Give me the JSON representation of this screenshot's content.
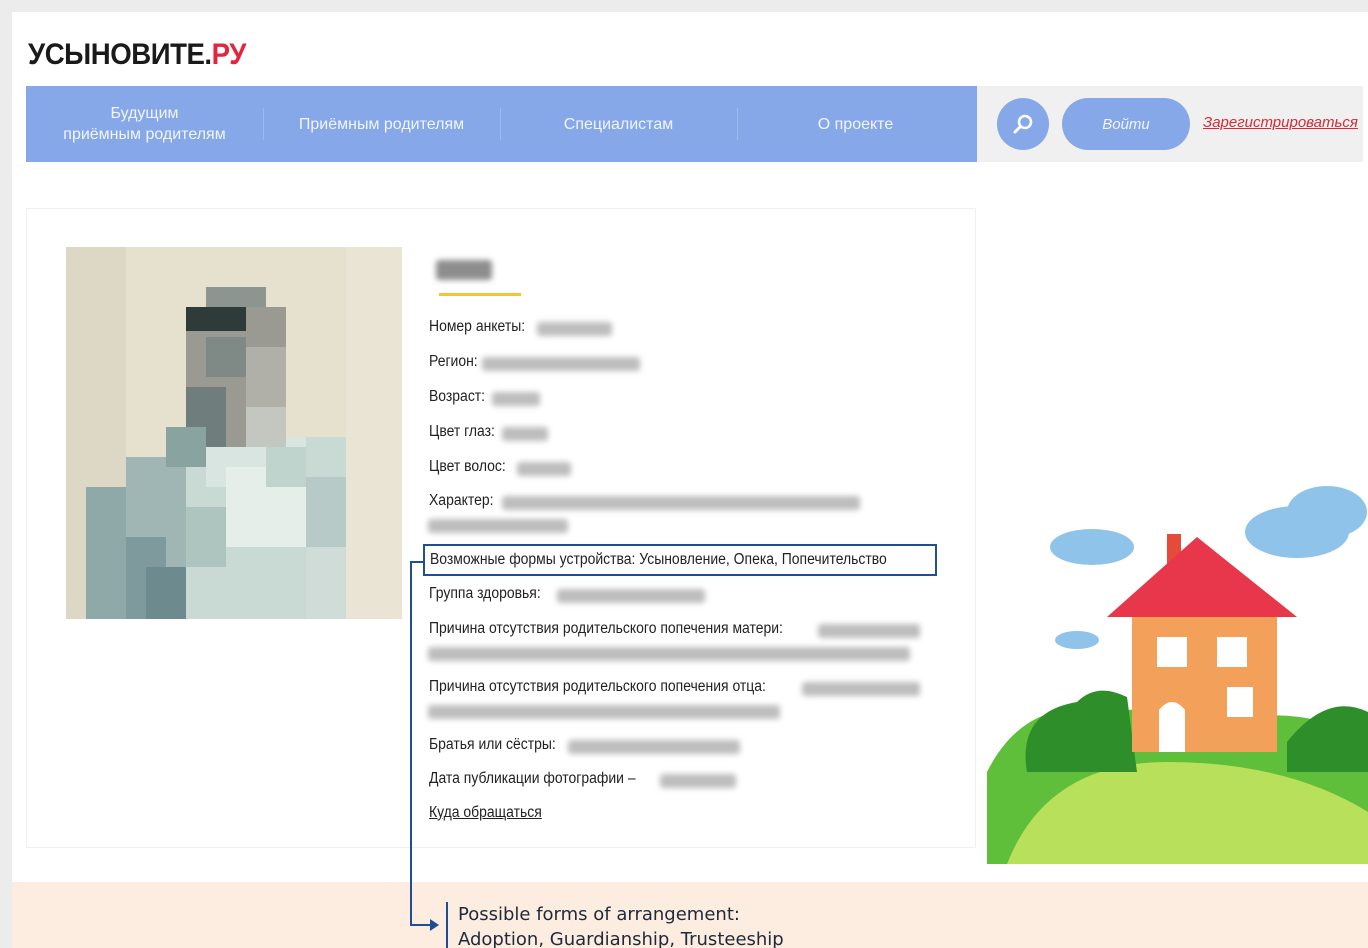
{
  "site": {
    "logo_main": "УСЫНОВИТЕ.",
    "logo_accent": "РУ"
  },
  "nav": {
    "items": [
      {
        "line1": "Будущим",
        "line2": "приёмным родителям"
      },
      {
        "line1": "Приёмным родителям",
        "line2": ""
      },
      {
        "line1": "Специалистам",
        "line2": ""
      },
      {
        "line1": "О проекте",
        "line2": ""
      }
    ],
    "search_icon": "search-icon",
    "login_label": "Войти",
    "register_label": "Зарегистрироваться"
  },
  "profile": {
    "fields": {
      "form_number": "Номер анкеты:",
      "region": "Регион:",
      "age": "Возраст:",
      "eye_color": "Цвет глаз:",
      "hair_color": "Цвет волос:",
      "character": "Характер:",
      "arrangement_forms": "Возможные формы устройства: Усыновление, Опека, Попечительство",
      "health_group": "Группа здоровья:",
      "mother_reason": "Причина отсутствия родительского попечения матери:",
      "father_reason": "Причина отсутствия родительского попечения отца:",
      "siblings": "Братья или сёстры:",
      "photo_date": "Дата публикации фотографии –"
    },
    "contact_link": "Куда обращаться"
  },
  "annotation": {
    "line1": "Possible forms of arrangement:",
    "line2": "Adoption, Guardianship, Trusteeship"
  },
  "colors": {
    "nav_blue": "#86a8e8",
    "logo_red": "#e3243b",
    "annotation_blue": "#1f4f93",
    "footer_band": "#fdece0"
  }
}
